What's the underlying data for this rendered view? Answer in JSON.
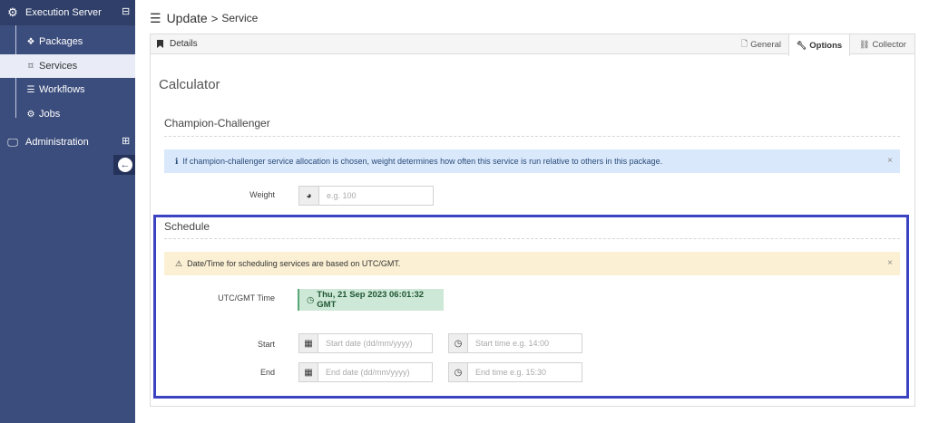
{
  "sidebar": {
    "execution_server": "Execution Server",
    "items": [
      {
        "label": "Packages",
        "icon": "cubes-icon"
      },
      {
        "label": "Services",
        "icon": "bookmark-icon"
      },
      {
        "label": "Workflows",
        "icon": "server-icon"
      },
      {
        "label": "Jobs",
        "icon": "cogs-icon"
      }
    ],
    "administration": "Administration",
    "expand_symbol": "⊞",
    "collapse_symbol": "⊟"
  },
  "header": {
    "title": "Update",
    "separator": ">",
    "subtitle": "Service"
  },
  "panel": {
    "title": "Details",
    "tabs": [
      {
        "label": "General",
        "icon": "file-icon"
      },
      {
        "label": "Options",
        "icon": "wrench-icon",
        "active": true
      },
      {
        "label": "Collector",
        "icon": "link-icon"
      }
    ]
  },
  "calculator": {
    "title": "Calculator"
  },
  "champion": {
    "title": "Champion-Challenger",
    "alert": "If champion-challenger service allocation is chosen, weight determines how often this service is run relative to others in this package.",
    "weight_label": "Weight",
    "weight_placeholder": "e.g. 100"
  },
  "schedule": {
    "title": "Schedule",
    "alert": "Date/Time for scheduling services are based on UTC/GMT.",
    "utc_label": "UTC/GMT Time",
    "utc_value": "Thu, 21 Sep 2023 06:01:32 GMT",
    "start_label": "Start",
    "end_label": "End",
    "start_date_placeholder": "Start date (dd/mm/yyyy)",
    "start_time_placeholder": "Start time e.g. 14:00",
    "end_date_placeholder": "End date (dd/mm/yyyy)",
    "end_time_placeholder": "End time e.g. 15:30"
  },
  "close_symbol": "×",
  "colors": {
    "sidebar": "#3b4d7c",
    "sidebar_top": "#2f3f69",
    "info_alert": "#d9e8fb",
    "warn_alert": "#fbf0d3",
    "time_badge": "#cde8d6",
    "highlight": "#3b43c1"
  }
}
